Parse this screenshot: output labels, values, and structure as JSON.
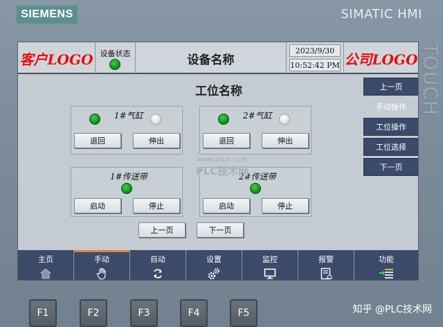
{
  "panel": {
    "brand": "SIEMENS",
    "model": "SIMATIC HMI",
    "side_text": "TOUCH"
  },
  "header": {
    "customer_logo": "客户LOGO",
    "device_status_label": "设备状态",
    "device_name": "设备名称",
    "date": "2023/9/30",
    "time": "10:52:42 PM",
    "company_logo": "公司LOGO"
  },
  "main": {
    "station_title": "工位名称",
    "cylinder1": {
      "label": "1#气缸",
      "retract": "退回",
      "extend": "伸出"
    },
    "cylinder2": {
      "label": "2#气缸",
      "retract": "退回",
      "extend": "伸出"
    },
    "conveyor1": {
      "label": "1#传送带",
      "start": "启动",
      "stop": "停止"
    },
    "conveyor2": {
      "label": "2#传送带",
      "start": "启动",
      "stop": "停止"
    },
    "prev_page": "上一页",
    "next_page": "下一页"
  },
  "watermark": {
    "url": "www.plcjs.com",
    "name": "PLC技术网"
  },
  "side_menu": {
    "items": [
      {
        "label": "上一页"
      },
      {
        "label": "手动操作"
      },
      {
        "label": "工位操作"
      },
      {
        "label": "工位选择"
      },
      {
        "label": "下一页"
      }
    ]
  },
  "navbar": {
    "items": [
      {
        "label": "主页",
        "icon": "home-icon"
      },
      {
        "label": "手动",
        "icon": "hand-icon"
      },
      {
        "label": "自动",
        "icon": "refresh-icon"
      },
      {
        "label": "设置",
        "icon": "gears-icon"
      },
      {
        "label": "监控",
        "icon": "monitor-icon"
      },
      {
        "label": "报警",
        "icon": "alarm-icon"
      },
      {
        "label": "功能",
        "icon": "function-icon"
      }
    ]
  },
  "fkeys": [
    "F1",
    "F2",
    "F3",
    "F4",
    "F5"
  ],
  "footer": {
    "credit": "知乎 @PLC技术网"
  },
  "colors": {
    "led_on": "#16911f",
    "logo_red": "#e01010",
    "nav_bg": "#3c4a69",
    "active_tab": "#e2803a"
  }
}
